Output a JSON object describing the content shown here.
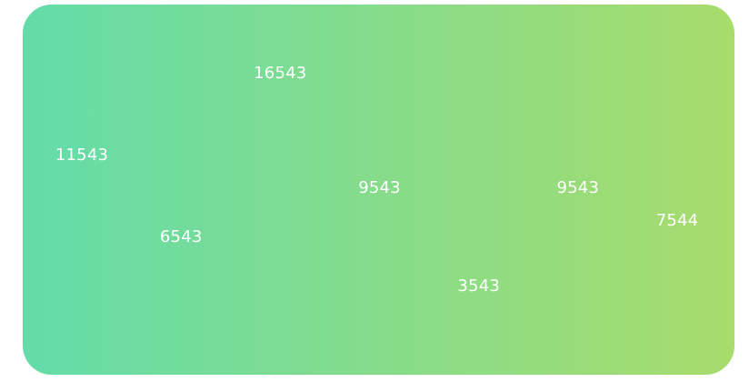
{
  "colors": {
    "gradient_start": "#63DCAA",
    "gradient_end": "#A8DC6C",
    "label": "#FFFFFF"
  },
  "chart_data": {
    "type": "line",
    "title": "",
    "xlabel": "",
    "ylabel": "",
    "categories": [
      "",
      "",
      "",
      "",
      "",
      "",
      ""
    ],
    "values": [
      11543,
      6543,
      16543,
      9543,
      3543,
      9543,
      7544
    ],
    "value_labels": [
      "11543",
      "6543",
      "16543",
      "9543",
      "3543",
      "9543",
      "7544"
    ],
    "ylim": [
      0,
      20000
    ],
    "grid": false,
    "legend": "none",
    "show_line": false,
    "show_data_labels": true
  }
}
